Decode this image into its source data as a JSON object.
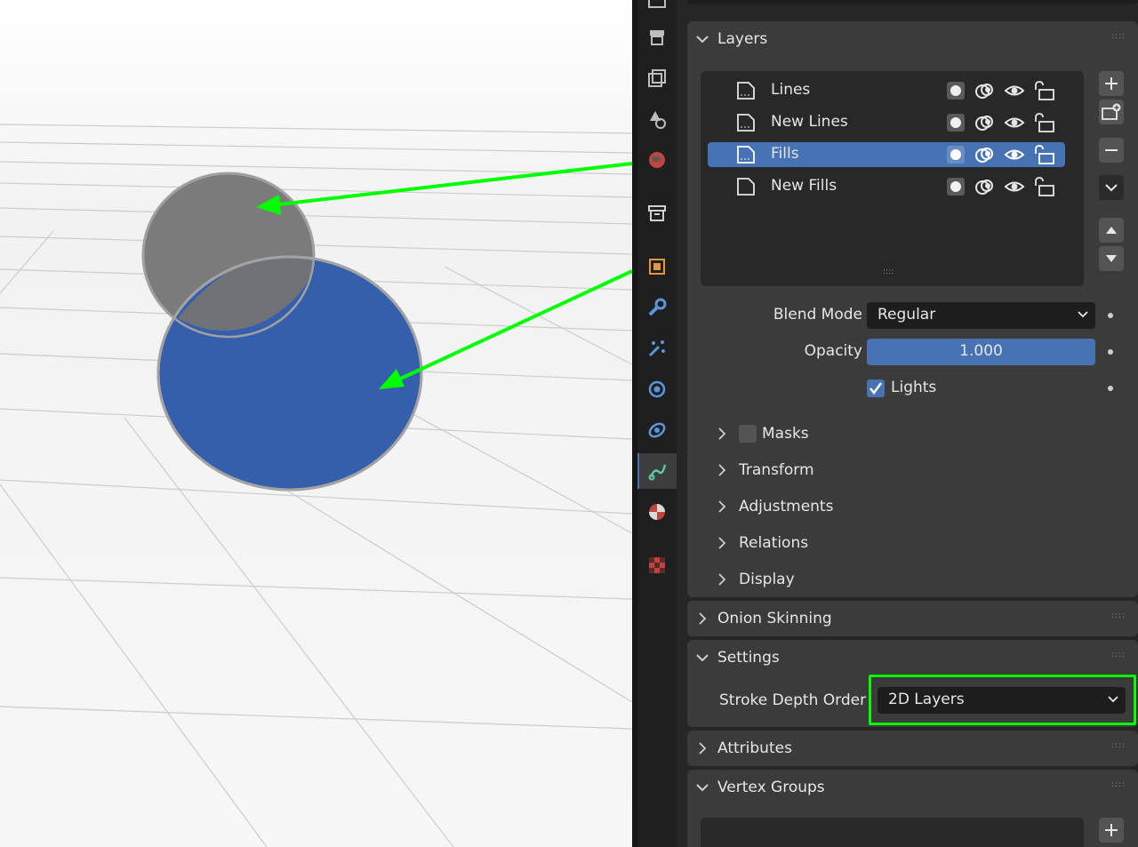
{
  "layers_panel": {
    "title": "Layers",
    "layers": [
      {
        "name": "Lines"
      },
      {
        "name": "New Lines"
      },
      {
        "name": "Fills"
      },
      {
        "name": "New Fills"
      }
    ],
    "blend_mode_label": "Blend Mode",
    "blend_mode_value": "Regular",
    "opacity_label": "Opacity",
    "opacity_value": "1.000",
    "lights_label": "Lights",
    "lights_checked": true,
    "subpanels": {
      "masks": "Masks",
      "transform": "Transform",
      "adjustments": "Adjustments",
      "relations": "Relations",
      "display": "Display"
    }
  },
  "onion_skinning": {
    "title": "Onion Skinning"
  },
  "settings_panel": {
    "title": "Settings",
    "stroke_depth_label": "Stroke Depth Order",
    "stroke_depth_value": "2D Layers"
  },
  "attributes_panel": {
    "title": "Attributes"
  },
  "vertex_groups_panel": {
    "title": "Vertex Groups"
  },
  "colors": {
    "selection": "#4772b3",
    "annotation_green": "#00ff00",
    "blue_fill": "#355fac",
    "gray_fill": "#7b7b7b"
  }
}
